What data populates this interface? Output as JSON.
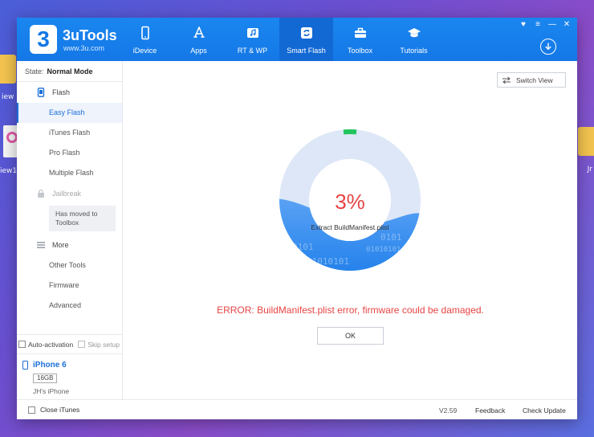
{
  "desktop": {
    "left_label_1": "iew",
    "left_label_2": "iew1",
    "right_label": "Jr"
  },
  "app": {
    "brand_name": "3uTools",
    "brand_url": "www.3u.com",
    "logo_digit": "3"
  },
  "nav": [
    {
      "label": "iDevice",
      "icon": "phone-icon"
    },
    {
      "label": "Apps",
      "icon": "app-store-icon"
    },
    {
      "label": "RT & WP",
      "icon": "music-icon"
    },
    {
      "label": "Smart Flash",
      "icon": "flash-icon"
    },
    {
      "label": "Toolbox",
      "icon": "toolbox-icon"
    },
    {
      "label": "Tutorials",
      "icon": "graduation-cap-icon"
    }
  ],
  "sidebar": {
    "state_label": "State:",
    "state_value": "Normal Mode",
    "flash_title": "Flash",
    "flash_items": [
      "Easy Flash",
      "iTunes Flash",
      "Pro Flash",
      "Multiple Flash"
    ],
    "jailbreak_title": "Jailbreak",
    "jailbreak_note": "Has moved to Toolbox",
    "more_title": "More",
    "more_items": [
      "Other Tools",
      "Firmware",
      "Advanced"
    ],
    "auto_activation": "Auto-activation",
    "skip_setup": "Skip setup"
  },
  "device": {
    "name": "iPhone 6",
    "capacity": "16GB",
    "owner": "JH's iPhone"
  },
  "main": {
    "switch_view": "Switch View",
    "progress": 3,
    "progress_text": "3%",
    "status_text": "Extract BuildManifest.plist",
    "binary_text_1": "0101",
    "binary_text_2": "01010101",
    "binary_text_3": "01010101",
    "binary_text_4": "0101",
    "error_message": "ERROR: BuildManifest.plist error, firmware could be damaged.",
    "ok_label": "OK"
  },
  "bottom": {
    "close_itunes": "Close iTunes",
    "version": "V2.59",
    "feedback": "Feedback",
    "check_update": "Check Update"
  },
  "colors": {
    "brand_blue": "#1478e6",
    "error_red": "#e64444",
    "progress_green": "#22c55e"
  }
}
